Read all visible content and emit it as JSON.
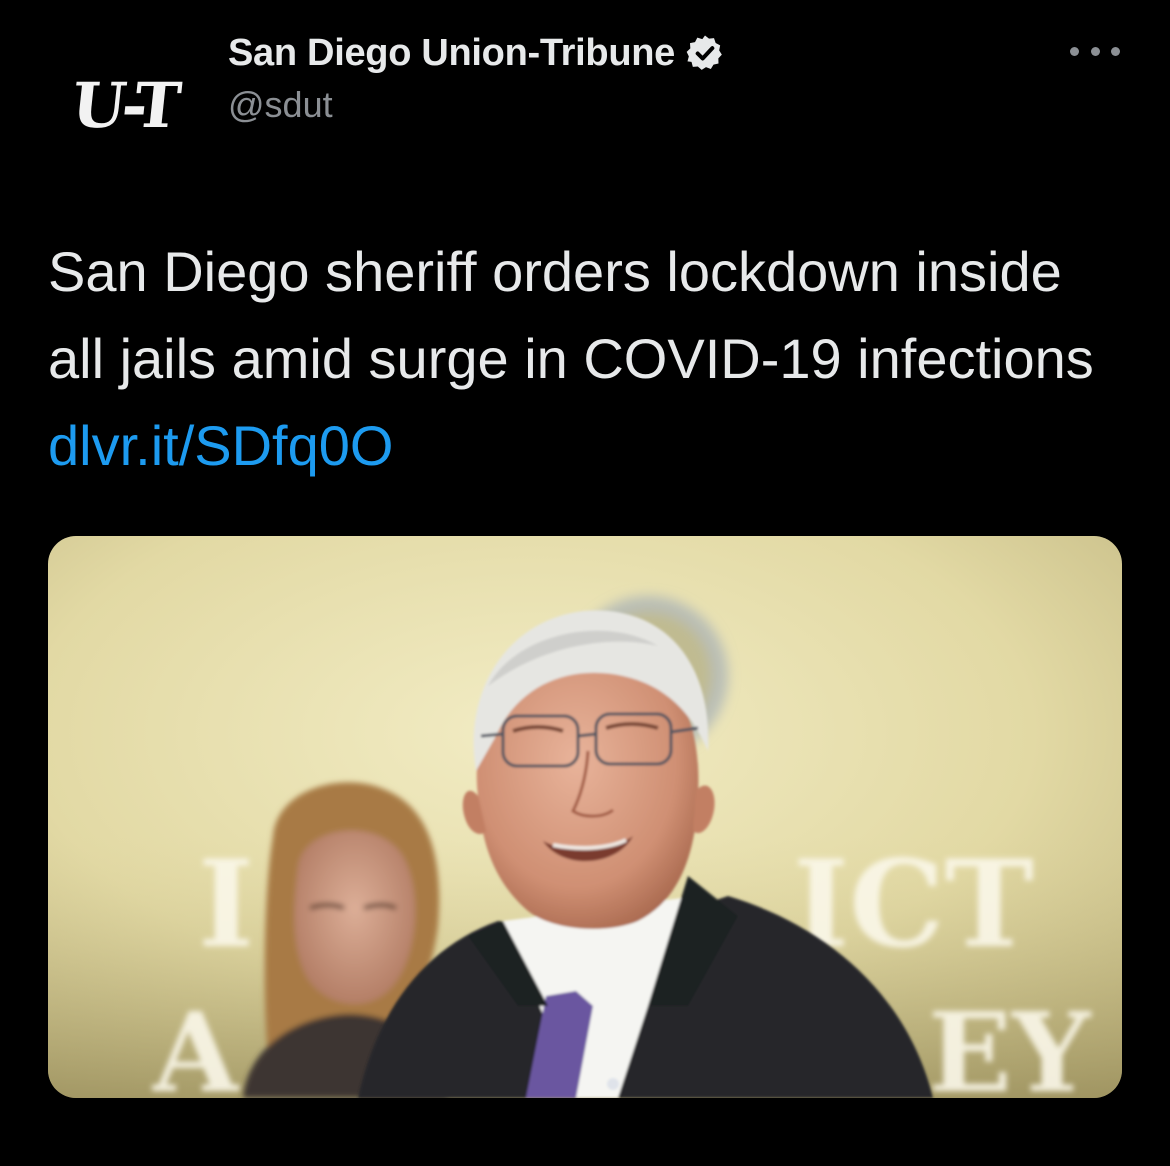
{
  "author": {
    "avatar_text": "U-T",
    "display_name": "San Diego Union-Tribune",
    "handle": "@sdut",
    "verified": true
  },
  "menu": {
    "icon": "more-horizontal-icon"
  },
  "tweet": {
    "text": "San Diego sheriff orders lockdown inside all jails amid surge in COVID-19 infections",
    "link_text": "dlvr.it/SDfq0O"
  },
  "media": {
    "backdrop_text": [
      "I",
      "ICT",
      "A",
      "EY"
    ]
  },
  "colors": {
    "background": "#000000",
    "text": "#e7e9ea",
    "secondary": "#8b8f94",
    "link": "#1d9bf0",
    "verified_badge": "#e7e9ea"
  }
}
